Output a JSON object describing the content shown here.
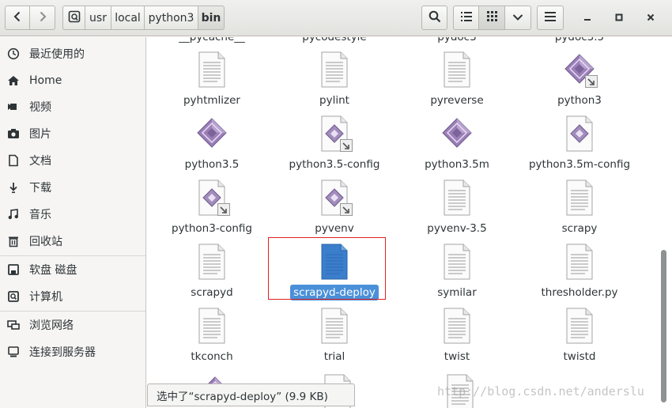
{
  "toolbar": {
    "back_icon": "chevron-left-icon",
    "forward_icon": "chevron-right-icon",
    "root_icon": "drive-icon",
    "breadcrumbs": [
      "usr",
      "local",
      "python3",
      "bin"
    ],
    "search_icon": "search-icon",
    "list_view_icon": "list-view-icon",
    "grid_view_icon": "grid-view-icon",
    "view_options_icon": "chevron-down-icon",
    "menu_icon": "hamburger-menu-icon",
    "minimize": "_",
    "maximize": "□",
    "close": "✕"
  },
  "sidebar": {
    "items": [
      {
        "label": "最近使用的",
        "icon": "clock-icon"
      },
      {
        "label": "Home",
        "icon": "home-icon"
      },
      {
        "label": "视频",
        "icon": "video-icon"
      },
      {
        "label": "图片",
        "icon": "camera-icon"
      },
      {
        "label": "文档",
        "icon": "document-icon"
      },
      {
        "label": "下载",
        "icon": "download-icon"
      },
      {
        "label": "音乐",
        "icon": "music-icon"
      },
      {
        "label": "回收站",
        "icon": "trash-icon"
      },
      {
        "label": "软盘 磁盘",
        "icon": "floppy-disk-icon"
      },
      {
        "label": "计算机",
        "icon": "computer-icon"
      },
      {
        "label": "浏览网络",
        "icon": "network-icon"
      },
      {
        "label": "连接到服务器",
        "icon": "server-icon"
      }
    ]
  },
  "files": {
    "partial_top": [
      "__pycache__",
      "pycodestyle",
      "pydoc3",
      "pydoc3.5"
    ],
    "rows": [
      [
        {
          "name": "pyhtmlizer",
          "type": "text"
        },
        {
          "name": "pylint",
          "type": "text"
        },
        {
          "name": "pyreverse",
          "type": "text"
        },
        {
          "name": "python3",
          "type": "exec-link"
        }
      ],
      [
        {
          "name": "python3.5",
          "type": "exec"
        },
        {
          "name": "python3.5-config",
          "type": "script-link"
        },
        {
          "name": "python3.5m",
          "type": "exec"
        },
        {
          "name": "python3.5m-config",
          "type": "script"
        }
      ],
      [
        {
          "name": "python3-config",
          "type": "script-link"
        },
        {
          "name": "pyvenv",
          "type": "script-link"
        },
        {
          "name": "pyvenv-3.5",
          "type": "text"
        },
        {
          "name": "scrapy",
          "type": "text"
        }
      ],
      [
        {
          "name": "scrapyd",
          "type": "text"
        },
        {
          "name": "scrapyd-deploy",
          "type": "text-selected"
        },
        {
          "name": "symilar",
          "type": "text"
        },
        {
          "name": "thresholder.py",
          "type": "text"
        }
      ],
      [
        {
          "name": "tkconch",
          "type": "text"
        },
        {
          "name": "trial",
          "type": "text"
        },
        {
          "name": "twist",
          "type": "text"
        },
        {
          "name": "twistd",
          "type": "text"
        }
      ]
    ]
  },
  "status": {
    "text": "选中了“scrapyd-deploy” (9.9 KB)"
  },
  "watermark": "http://blog.csdn.net/anderslu",
  "colors": {
    "selection": "#4a90d9",
    "highlight_box": "#e02020",
    "exec_purple": "#9b7fb8"
  }
}
